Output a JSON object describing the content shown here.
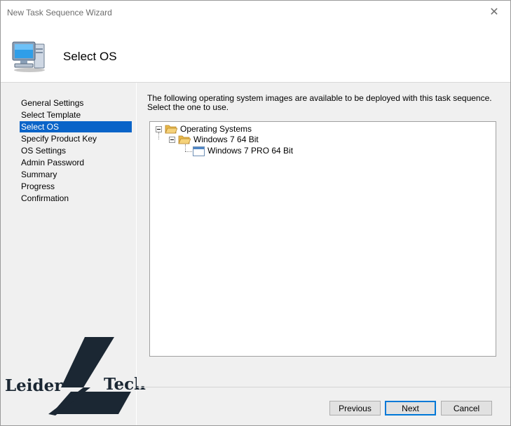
{
  "window": {
    "title": "New Task Sequence Wizard",
    "close_glyph": "✕"
  },
  "header": {
    "title": "Select OS",
    "icon": "computer-icon"
  },
  "nav": {
    "items": [
      {
        "label": "General Settings",
        "selected": false
      },
      {
        "label": "Select Template",
        "selected": false
      },
      {
        "label": "Select OS",
        "selected": true
      },
      {
        "label": "Specify Product Key",
        "selected": false
      },
      {
        "label": "OS Settings",
        "selected": false
      },
      {
        "label": "Admin Password",
        "selected": false
      },
      {
        "label": "Summary",
        "selected": false
      },
      {
        "label": "Progress",
        "selected": false
      },
      {
        "label": "Confirmation",
        "selected": false
      }
    ]
  },
  "content": {
    "description": "The following operating system images are available to be deployed with this task sequence.  Select the one to use.",
    "tree": {
      "root": {
        "label": "Operating Systems",
        "icon": "folder-open-icon"
      },
      "group": {
        "label": "Windows 7 64 Bit",
        "icon": "folder-open-icon"
      },
      "image": {
        "label": "Windows 7 PRO 64 Bit",
        "icon": "os-image-icon"
      }
    }
  },
  "buttons": {
    "previous": "Previous",
    "next": "Next",
    "cancel": "Cancel"
  },
  "watermark": {
    "left_text": "Leider",
    "right_text": "Tech",
    "color": "#1b2733"
  },
  "colors": {
    "selection": "#0a64c8",
    "panel": "#f0f0f0"
  }
}
